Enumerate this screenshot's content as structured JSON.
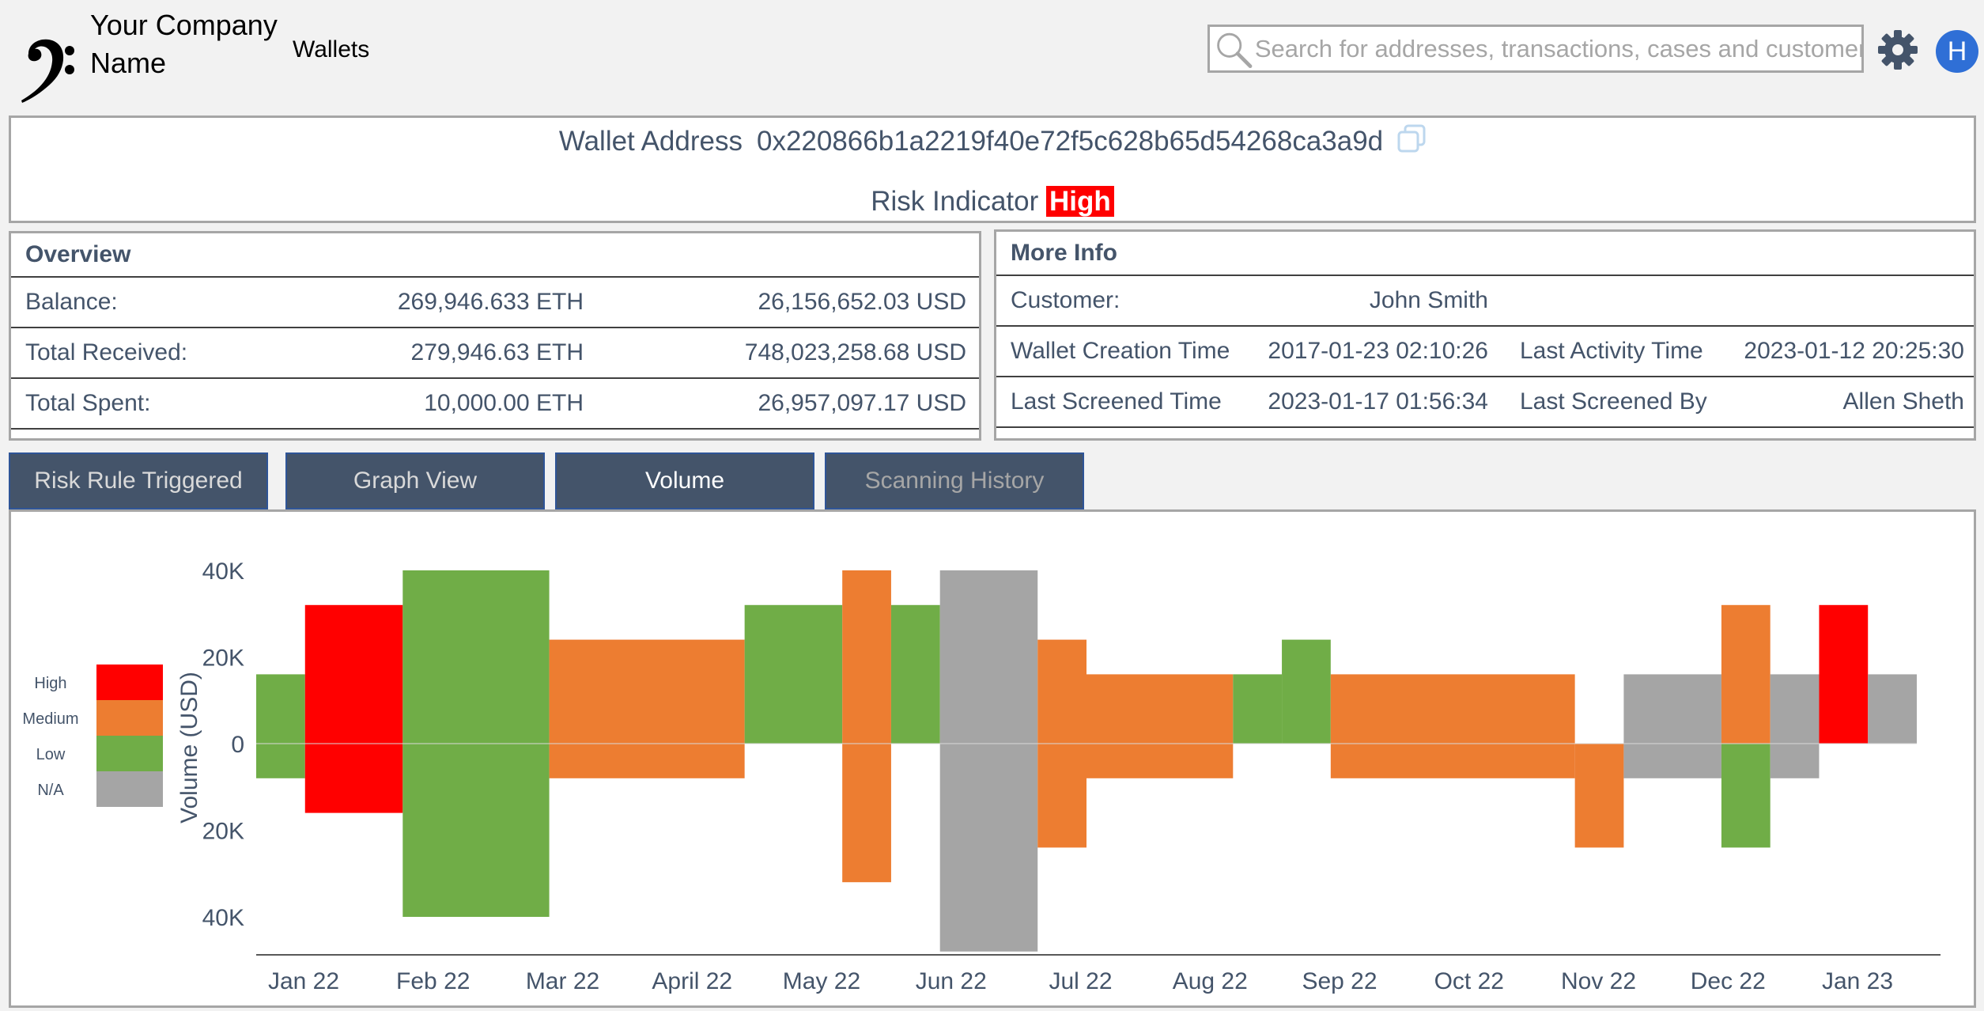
{
  "header": {
    "company_name": "Your Company Name",
    "nav_wallets": "Wallets",
    "search_placeholder": "Search for addresses, transactions, cases and customers...",
    "avatar_initial": "H",
    "icons": [
      "logo-icon",
      "search-icon",
      "gear-icon"
    ]
  },
  "wallet": {
    "address_label": "Wallet Address",
    "address": "0x220866b1a2219f40e72f5c628b65d54268ca3a9d",
    "risk_label": "Risk Indicator",
    "risk_value": "High",
    "risk_color": "#ff0000"
  },
  "overview": {
    "title": "Overview",
    "rows": [
      {
        "label": "Balance:",
        "eth": "269,946.633 ETH",
        "usd": "26,156,652.03 USD"
      },
      {
        "label": "Total Received:",
        "eth": "279,946.63 ETH",
        "usd": "748,023,258.68 USD"
      },
      {
        "label": "Total Spent:",
        "eth": "10,000.00 ETH",
        "usd": "26,957,097.17 USD"
      }
    ]
  },
  "more_info": {
    "title": "More Info",
    "customer_label": "Customer:",
    "customer": "John Smith",
    "creation_label": "Wallet Creation Time",
    "creation": "2017-01-23 02:10:26",
    "last_activity_label": "Last Activity Time",
    "last_activity": "2023-01-12 20:25:30",
    "last_screened_label": "Last Screened Time",
    "last_screened": "2023-01-17 01:56:34",
    "screened_by_label": "Last Screened By",
    "screened_by": "Allen Sheth"
  },
  "tabs": [
    {
      "label": "Risk Rule Triggered",
      "state": "normal"
    },
    {
      "label": "Graph View",
      "state": "normal"
    },
    {
      "label": "Volume",
      "state": "active"
    },
    {
      "label": "Scanning History",
      "state": "dim"
    }
  ],
  "chart_data": {
    "type": "bar",
    "ylabel": "Volume (USD)",
    "yticks": [
      "40K",
      "20K",
      "0",
      "20K",
      "40K"
    ],
    "ylim": [
      -48000,
      40000
    ],
    "categories": [
      "Jan 22",
      "Feb 22",
      "Mar 22",
      "April 22",
      "May 22",
      "Jun 22",
      "Jul 22",
      "Aug 22",
      "Sep 22",
      "Oct 22",
      "Nov 22",
      "Dec 22",
      "Jan 23"
    ],
    "legend": [
      {
        "name": "High",
        "color": "#ff0000"
      },
      {
        "name": "Medium",
        "color": "#ed7d31"
      },
      {
        "name": "Low",
        "color": "#70ad47"
      },
      {
        "name": "N/A",
        "color": "#a5a5a5"
      }
    ],
    "x_range": [
      0,
      34
    ],
    "bars": [
      {
        "x0": 0,
        "x1": 1,
        "received": 16000,
        "spent": -8000,
        "risk": "Low"
      },
      {
        "x0": 1,
        "x1": 3,
        "received": 32000,
        "spent": -16000,
        "risk": "High"
      },
      {
        "x0": 3,
        "x1": 6,
        "received": 40000,
        "spent": -40000,
        "risk": "Low"
      },
      {
        "x0": 6,
        "x1": 10,
        "received": 24000,
        "spent": -8000,
        "risk": "Medium"
      },
      {
        "x0": 10,
        "x1": 12,
        "received": 32000,
        "spent": 0,
        "risk": "Low"
      },
      {
        "x0": 12,
        "x1": 13,
        "received": 40000,
        "spent": -32000,
        "risk": "Medium"
      },
      {
        "x0": 13,
        "x1": 14,
        "received": 32000,
        "spent": 0,
        "risk": "Low"
      },
      {
        "x0": 14,
        "x1": 16,
        "received": 40000,
        "spent": -48000,
        "risk": "N/A"
      },
      {
        "x0": 16,
        "x1": 17,
        "received": 24000,
        "spent": -24000,
        "risk": "Medium"
      },
      {
        "x0": 17,
        "x1": 20,
        "received": 16000,
        "spent": -8000,
        "risk": "Medium"
      },
      {
        "x0": 20,
        "x1": 21,
        "received": 16000,
        "spent": 0,
        "risk": "Low"
      },
      {
        "x0": 21,
        "x1": 22,
        "received": 24000,
        "spent": 0,
        "risk": "Low"
      },
      {
        "x0": 22,
        "x1": 27,
        "received": 16000,
        "spent": -8000,
        "risk": "Medium"
      },
      {
        "x0": 27,
        "x1": 28,
        "received": 0,
        "spent": -24000,
        "risk": "Medium"
      },
      {
        "x0": 28,
        "x1": 30,
        "received": 16000,
        "spent": -8000,
        "risk": "N/A"
      },
      {
        "x0": 30,
        "x1": 31,
        "received": 32000,
        "spent": 0,
        "risk": "Medium"
      },
      {
        "x0": 30,
        "x1": 31,
        "received": 0,
        "spent": -24000,
        "risk": "Low"
      },
      {
        "x0": 31,
        "x1": 32,
        "received": 16000,
        "spent": -8000,
        "risk": "N/A"
      },
      {
        "x0": 32,
        "x1": 33,
        "received": 32000,
        "spent": 0,
        "risk": "High"
      },
      {
        "x0": 33,
        "x1": 34,
        "received": 16000,
        "spent": 0,
        "risk": "N/A"
      }
    ]
  }
}
